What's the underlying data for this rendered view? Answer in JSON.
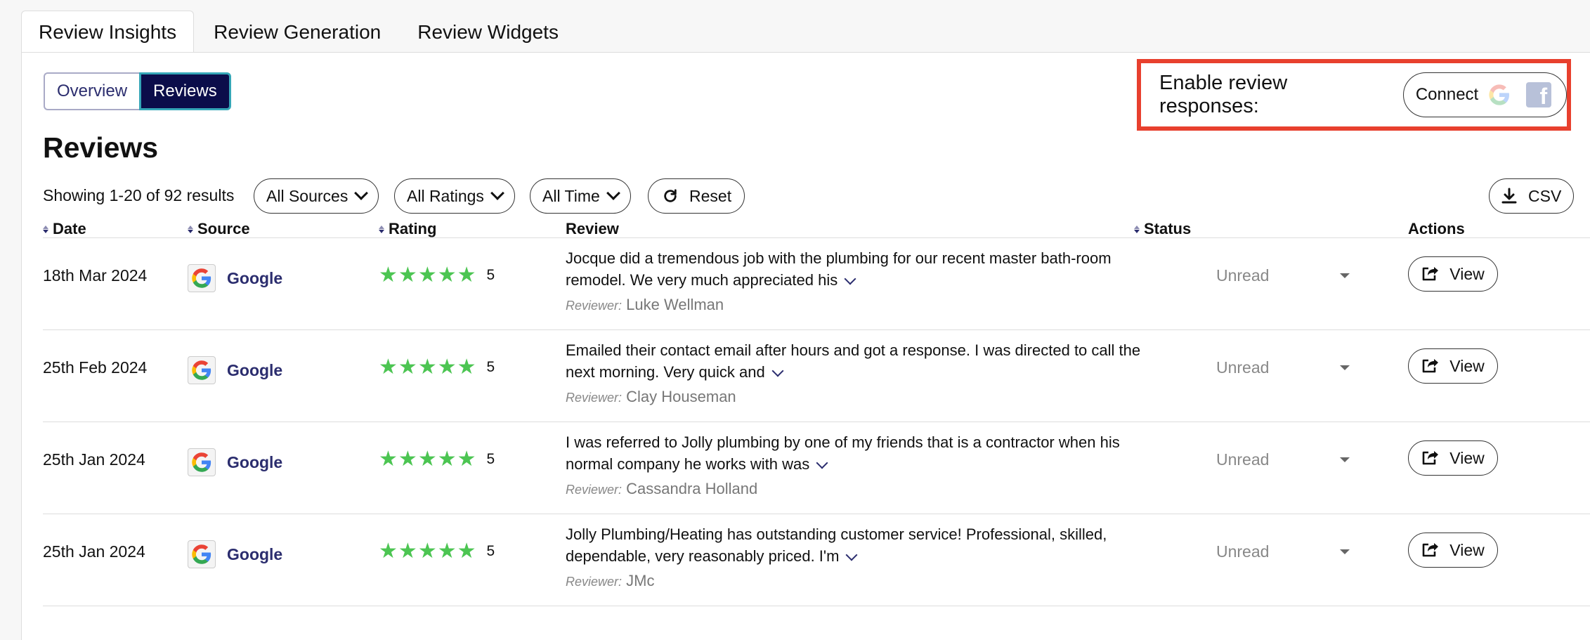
{
  "top_tabs": [
    {
      "label": "Review Insights",
      "active": true
    },
    {
      "label": "Review Generation",
      "active": false
    },
    {
      "label": "Review Widgets",
      "active": false
    }
  ],
  "view_toggle": {
    "overview": "Overview",
    "reviews": "Reviews",
    "selected": "Reviews"
  },
  "connect": {
    "label": "Enable review responses:",
    "button": "Connect",
    "icons": [
      "google-icon",
      "facebook-icon"
    ]
  },
  "page_title": "Reviews",
  "results_text": "Showing 1-20 of 92 results",
  "filters": {
    "sources": "All Sources",
    "ratings": "All Ratings",
    "time": "All Time",
    "reset": "Reset",
    "csv": "CSV"
  },
  "columns": {
    "date": "Date",
    "source": "Source",
    "rating": "Rating",
    "review": "Review",
    "status": "Status",
    "actions": "Actions"
  },
  "reviewer_label": "Reviewer:",
  "rows": [
    {
      "date": "18th Mar 2024",
      "source": "Google",
      "rating": "5",
      "text": "Jocque did a tremendous job with the plumbing for our recent master bath-room remodel. We very much appreciated his",
      "reviewer": "Luke Wellman",
      "status": "Unread",
      "action": "View"
    },
    {
      "date": "25th Feb 2024",
      "source": "Google",
      "rating": "5",
      "text": "Emailed their contact email after hours and got a response. I was directed to call the next morning. Very quick and",
      "reviewer": "Clay Houseman",
      "status": "Unread",
      "action": "View"
    },
    {
      "date": "25th Jan 2024",
      "source": "Google",
      "rating": "5",
      "text": "I was referred to Jolly plumbing by one of my friends that is a contractor when his normal company he works with was",
      "reviewer": "Cassandra Holland",
      "status": "Unread",
      "action": "View"
    },
    {
      "date": "25th Jan 2024",
      "source": "Google",
      "rating": "5",
      "text": "Jolly Plumbing/Heating has outstanding customer service! Professional, skilled, dependable, very reasonably priced. I'm",
      "reviewer": "JMc",
      "status": "Unread",
      "action": "View"
    }
  ],
  "colors": {
    "accent_navy": "#0b0d4a",
    "link": "#2b2d6e",
    "star": "#4cc552",
    "highlight": "#e8402e"
  }
}
